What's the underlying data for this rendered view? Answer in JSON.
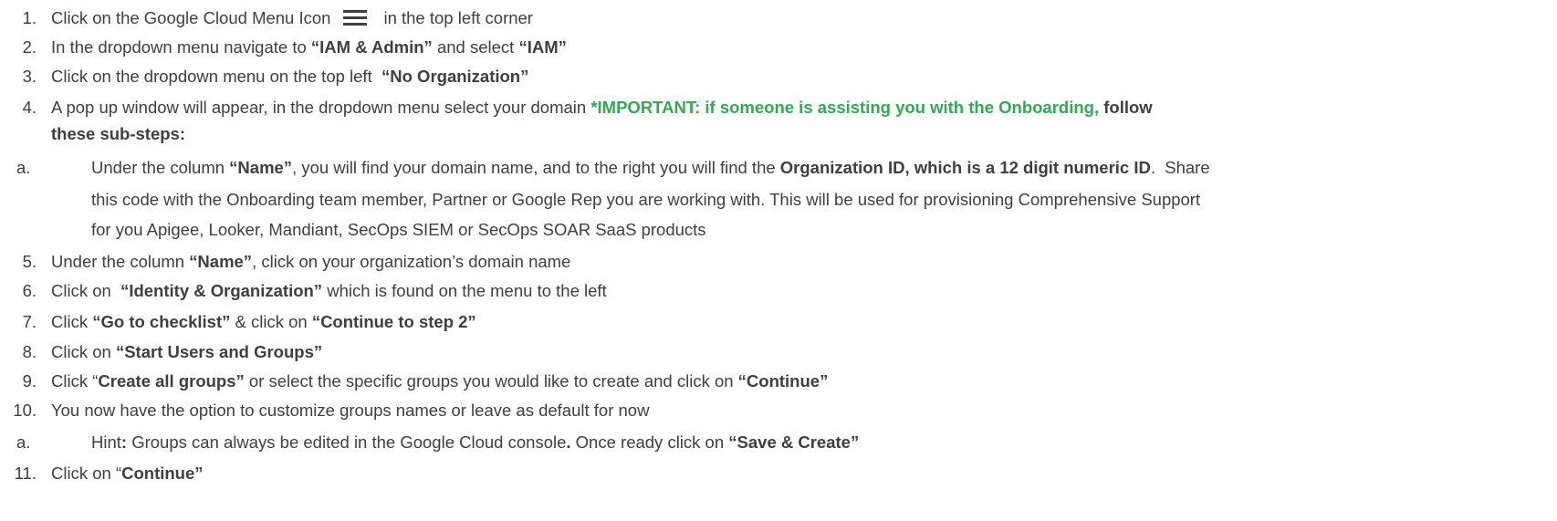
{
  "steps": [
    {
      "num": "1.",
      "a": "Click on the Google Cloud Menu Icon",
      "icon": "hamburger-menu-icon",
      "b": "in the top left corner"
    },
    {
      "num": "2.",
      "a": "In the dropdown menu navigate to ",
      "b1": "“IAM & Admin”",
      "c": " and select ",
      "b2": "“IAM”"
    },
    {
      "num": "3.",
      "a": "Click on the dropdown menu on the top left  ",
      "b1": "“No Organization”"
    },
    {
      "num": "4.",
      "a": "A pop up window will appear, in the dropdown menu select your domain ",
      "g1": "*IMPORTANT: if someone is assisting you with the Onboarding,",
      "b1": " follow",
      "b2": "these sub-steps:"
    },
    {
      "num": "a.",
      "a": "Under the column ",
      "b1": "“Name”",
      "c": ", you will find your domain name, and to the right you will find the ",
      "b2": "Organization ID, which is a 12 digit numeric ID",
      "d": ".  Share",
      "e": "this code with the Onboarding team member, Partner or Google Rep you are working with. This will be used for provisioning Comprehensive Support",
      "f": "for you Apigee, Looker, Mandiant, SecOps SIEM or SecOps SOAR SaaS products"
    },
    {
      "num": "5.",
      "a": "Under the column ",
      "b1": "“Name”",
      "c": ", click on your organization’s domain name"
    },
    {
      "num": "6.",
      "a": "Click on  ",
      "b1": "“Identity & Organization”",
      "c": " which is found on the menu to the left"
    },
    {
      "num": "7.",
      "a": "Click ",
      "b1": "“Go to checklist”",
      "c": " & click on ",
      "b2": "“Continue to step 2”"
    },
    {
      "num": "8.",
      "a": "Click on ",
      "b1": "“Start Users and Groups”"
    },
    {
      "num": "9.",
      "a": "Click “",
      "b1": "Create all groups”",
      "c": " or select the specific groups you would like to create and click on ",
      "b2": "“Continue”"
    },
    {
      "num": "10.",
      "a": "You now have the option to customize groups names or leave as default for now"
    },
    {
      "num": "a.",
      "a": "Hint",
      "b0": ":",
      "c": " Groups can always be edited in the Google Cloud console",
      "b1": ".",
      "d": " Once ready click on ",
      "b2": "“Save & Create”"
    },
    {
      "num": "11.",
      "a": "Click on “",
      "b1": "Continue”"
    }
  ]
}
